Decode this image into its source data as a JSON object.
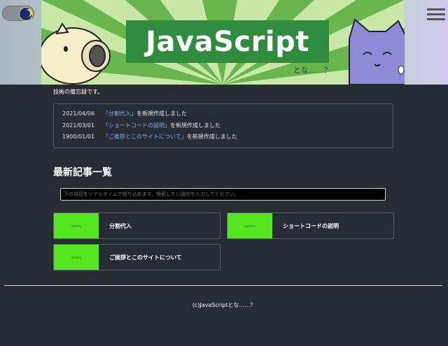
{
  "header": {
    "logo_text": "JavaScript",
    "logo_sub": "とな……？",
    "theme_toggle_icon": "moon-icon",
    "menu_icon": "hamburger-menu-icon"
  },
  "intro": {
    "text": "技術の備忘録です。"
  },
  "news": [
    {
      "date": "2021/04/06",
      "link": "「分割代入」",
      "suffix": "を新規作成しました"
    },
    {
      "date": "2021/03/01",
      "link": "「ショートコードの説明」",
      "suffix": "を新規作成しました"
    },
    {
      "date": "1900/01/01",
      "link": "「ご挨拶とこのサイトについて」",
      "suffix": "を新規作成しました"
    }
  ],
  "articles": {
    "title": "最新記事一覧",
    "search_placeholder": "下の項目をリアルタイムで絞り込めます。検索したい語句を入力してください。",
    "items": [
      {
        "thumb": "dummy",
        "title": "分割代入"
      },
      {
        "thumb": "dummy",
        "title": "ショートコードの説明"
      },
      {
        "thumb": "dummy",
        "title": "ご挨拶とこのサイトについて"
      }
    ]
  },
  "footer": {
    "text": "(c)JavaScriptとな……？"
  },
  "colors": {
    "background": "#272b33",
    "logo_green": "#2f8c3e",
    "thumb_green": "#55e61f",
    "link_blue": "#7fb4ff"
  }
}
